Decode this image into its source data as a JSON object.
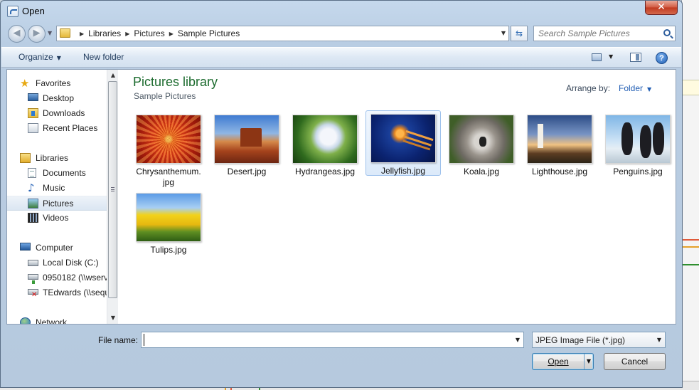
{
  "window": {
    "title": "Open",
    "close_glyph": "✕"
  },
  "address": {
    "crumbs": [
      "Libraries",
      "Pictures",
      "Sample Pictures"
    ],
    "search_placeholder": "Search Sample Pictures"
  },
  "toolbar": {
    "organize": "Organize",
    "new_folder": "New folder",
    "help": "?"
  },
  "nav": {
    "items": [
      {
        "label": "Favorites",
        "icon": "star-icon"
      },
      {
        "label": "Desktop",
        "icon": "desktop-icon"
      },
      {
        "label": "Downloads",
        "icon": "downloads-folder-icon"
      },
      {
        "label": "Recent Places",
        "icon": "recent-places-icon"
      },
      {
        "label": "Libraries",
        "icon": "libraries-icon"
      },
      {
        "label": "Documents",
        "icon": "documents-icon"
      },
      {
        "label": "Music",
        "icon": "music-icon"
      },
      {
        "label": "Pictures",
        "icon": "pictures-icon"
      },
      {
        "label": "Videos",
        "icon": "videos-icon"
      },
      {
        "label": "Computer",
        "icon": "computer-icon"
      },
      {
        "label": "Local Disk (C:)",
        "icon": "disk-icon"
      },
      {
        "label": "0950182 (\\\\wserv",
        "icon": "network-drive-icon"
      },
      {
        "label": "TEdwards (\\\\sequ",
        "icon": "disconnected-drive-icon"
      },
      {
        "label": "Network",
        "icon": "network-icon"
      }
    ]
  },
  "content": {
    "title": "Pictures library",
    "subtitle": "Sample Pictures",
    "arrange_label": "Arrange by:",
    "arrange_value": "Folder",
    "files": [
      {
        "name": "Chrysanthemum.",
        "name2": "jpg"
      },
      {
        "name": "Desert.jpg"
      },
      {
        "name": "Hydrangeas.jpg"
      },
      {
        "name": "Jellyfish.jpg",
        "selected": true
      },
      {
        "name": "Koala.jpg"
      },
      {
        "name": "Lighthouse.jpg"
      },
      {
        "name": "Penguins.jpg"
      },
      {
        "name": "Tulips.jpg"
      }
    ]
  },
  "footer": {
    "file_name_label": "File name:",
    "file_name_value": "",
    "file_type": "JPEG Image File (*.jpg)",
    "open_label": "Open",
    "cancel_label": "Cancel"
  },
  "colors": {
    "library_title": "#1c6b2e",
    "link_blue": "#1f5cb3",
    "selection": "#dceafa"
  }
}
